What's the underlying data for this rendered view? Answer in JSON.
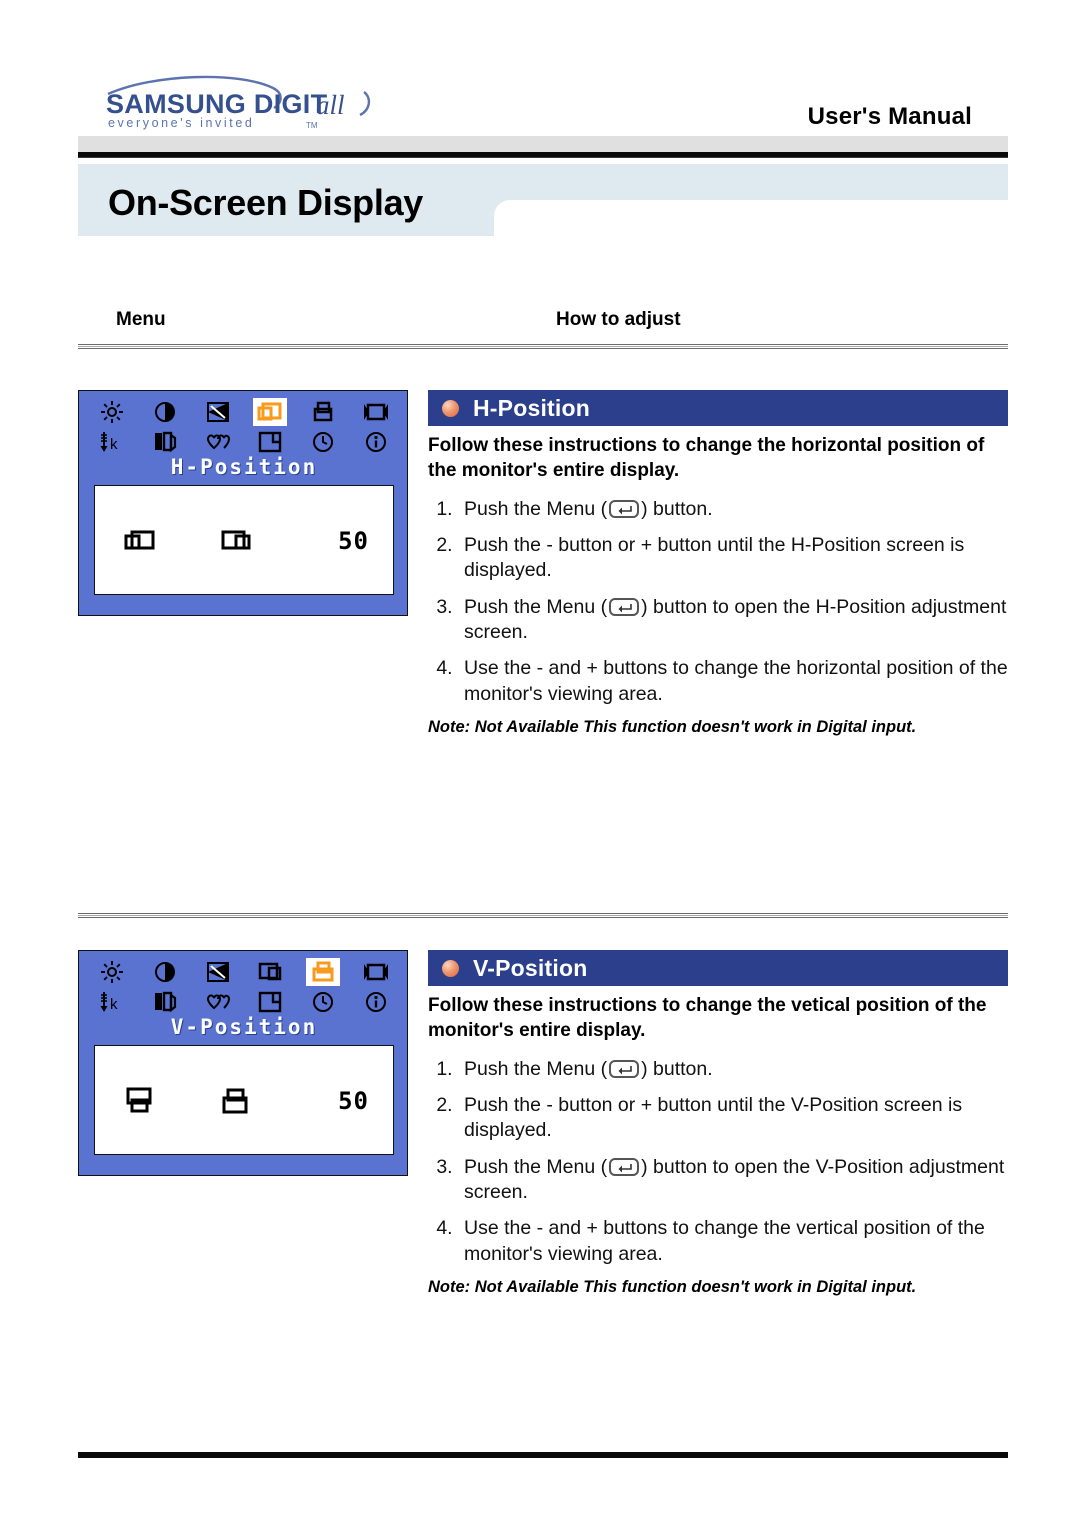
{
  "header": {
    "logo_primary": "SAMSUNG DIGITall",
    "logo_tagline": "everyone's invited",
    "logo_tm": "TM",
    "manual_title": "User's Manual"
  },
  "page_title": "On-Screen Display",
  "columns": {
    "menu": "Menu",
    "how_to_adjust": "How to adjust"
  },
  "sections": [
    {
      "id": "h-position",
      "title": "H-Position",
      "lead": "Follow these instructions to change the horizontal position of the monitor's entire display.",
      "steps": [
        {
          "pre": "Push the Menu (",
          "post": ") button."
        },
        {
          "pre": "Push the - button or + button until the H-Position screen is displayed.",
          "post": ""
        },
        {
          "pre": "Push the Menu (",
          "post": ") button to open the H-Position adjustment screen."
        },
        {
          "pre": "Use the - and + buttons to change the horizontal position of the monitor's viewing area.",
          "post": ""
        }
      ],
      "note": "Note: Not Available  This function doesn't work in Digital input.",
      "osd": {
        "label": "H-Position",
        "value": "50",
        "selected_index": 3,
        "icons_row1": [
          "brightness-icon",
          "contrast-icon",
          "sharpness-icon",
          "h-position-icon",
          "v-position-icon",
          "image-size-icon"
        ],
        "icons_row2": [
          "color-temperature-icon",
          "color-control-icon",
          "color-shape-icon",
          "osd-position-icon",
          "timer-icon",
          "information-icon"
        ],
        "panel_icons": [
          "h-position-left-icon",
          "h-position-right-icon"
        ]
      }
    },
    {
      "id": "v-position",
      "title": "V-Position",
      "lead": "Follow these instructions to change the vetical position of the monitor's entire display.",
      "steps": [
        {
          "pre": "Push the Menu (",
          "post": ") button."
        },
        {
          "pre": "Push the - button or + button until the V-Position screen is displayed.",
          "post": ""
        },
        {
          "pre": "Push the Menu (",
          "post": ") button to open the V-Position adjustment screen."
        },
        {
          "pre": "Use the - and + buttons to change the vertical position of the monitor's viewing area.",
          "post": ""
        }
      ],
      "note": "Note: Not Available  This function doesn't work in Digital input.",
      "osd": {
        "label": "V-Position",
        "value": "50",
        "selected_index": 4,
        "icons_row1": [
          "brightness-icon",
          "contrast-icon",
          "sharpness-icon",
          "h-position-icon",
          "v-position-icon",
          "image-size-icon"
        ],
        "icons_row2": [
          "color-temperature-icon",
          "color-control-icon",
          "color-shape-icon",
          "osd-position-icon",
          "timer-icon",
          "information-icon"
        ],
        "panel_icons": [
          "v-position-down-icon",
          "v-position-up-icon"
        ]
      }
    }
  ],
  "colors": {
    "osd_blue": "#5a73d0",
    "section_bar": "#2b3f8c",
    "highlight_orange": "#f79a1e",
    "title_banner": "#dfeaf0",
    "logo_blue": "#4a5fa0"
  }
}
